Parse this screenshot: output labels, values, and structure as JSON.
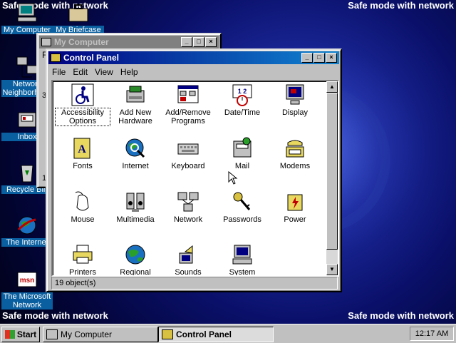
{
  "desktop": {
    "watermarks": [
      "Safe mode with network",
      "Safe mode with network",
      "Safe mode with network",
      "Safe mode with network"
    ],
    "icons": [
      {
        "label": "My Computer",
        "icon": "computer-icon"
      },
      {
        "label": "My Briefcase",
        "icon": "briefcase-icon"
      },
      {
        "label": "Network Neighborhood",
        "icon": "network-icon"
      },
      {
        "label": "Inbox",
        "icon": "inbox-icon"
      },
      {
        "label": "Recycle Bin",
        "icon": "recycle-bin-icon"
      },
      {
        "label": "The Internet",
        "icon": "internet-icon"
      },
      {
        "label": "The Microsoft Network",
        "icon": "msn-icon"
      }
    ]
  },
  "my_computer_window": {
    "title": "My Computer",
    "partial_menu": "F",
    "partial_text": "3",
    "partial_text2": "1"
  },
  "control_panel": {
    "title": "Control Panel",
    "menu": [
      "File",
      "Edit",
      "View",
      "Help"
    ],
    "items": [
      {
        "label": "Accessibility Options",
        "icon": "accessibility-icon"
      },
      {
        "label": "Add New Hardware",
        "icon": "hardware-icon"
      },
      {
        "label": "Add/Remove Programs",
        "icon": "programs-icon"
      },
      {
        "label": "Date/Time",
        "icon": "calendar-clock-icon"
      },
      {
        "label": "Display",
        "icon": "display-icon"
      },
      {
        "label": "Fonts",
        "icon": "fonts-icon"
      },
      {
        "label": "Internet",
        "icon": "internet-globe-icon"
      },
      {
        "label": "Keyboard",
        "icon": "keyboard-icon"
      },
      {
        "label": "Mail",
        "icon": "mail-icon"
      },
      {
        "label": "Modems",
        "icon": "modem-icon"
      },
      {
        "label": "Mouse",
        "icon": "mouse-icon"
      },
      {
        "label": "Multimedia",
        "icon": "multimedia-icon"
      },
      {
        "label": "Network",
        "icon": "network-icon"
      },
      {
        "label": "Passwords",
        "icon": "keys-icon"
      },
      {
        "label": "Power",
        "icon": "power-icon"
      },
      {
        "label": "Printers",
        "icon": "printer-icon"
      },
      {
        "label": "Regional",
        "icon": "globe-icon"
      },
      {
        "label": "Sounds",
        "icon": "speaker-icon"
      },
      {
        "label": "System",
        "icon": "system-icon"
      }
    ],
    "status": "19 object(s)"
  },
  "taskbar": {
    "start": "Start",
    "buttons": [
      "My Computer",
      "Control Panel"
    ],
    "clock": "12:17 AM"
  }
}
